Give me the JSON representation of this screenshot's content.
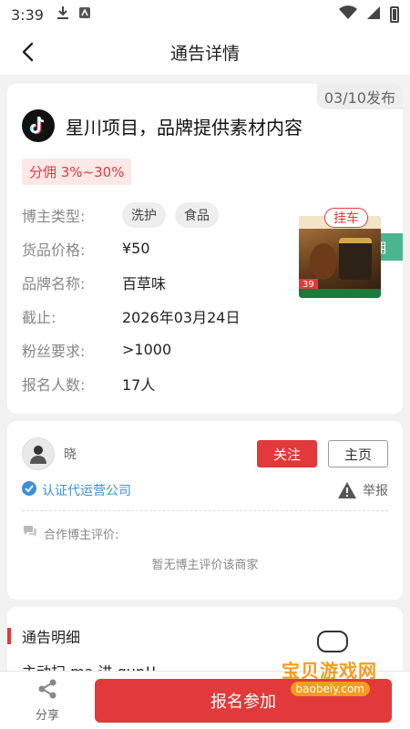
{
  "status_bar": {
    "time": "3:39"
  },
  "nav": {
    "title": "通告详情"
  },
  "ad": {
    "publish_date": "03/10发布",
    "title": "星川项目，品牌提供素材内容",
    "commission_range": "分佣 3%~30%",
    "commission_tag": "分佣",
    "hitch_badge": "挂车",
    "product_price_corner": "39",
    "info": [
      {
        "label": "博主类型:",
        "chips": [
          "洗护",
          "食品"
        ]
      },
      {
        "label": "货品价格:",
        "value": "¥50"
      },
      {
        "label": "品牌名称:",
        "value": "百草味"
      },
      {
        "label": "截止:",
        "value": "2026年03月24日"
      },
      {
        "label": "粉丝要求:",
        "value": ">1000"
      },
      {
        "label": "报名人数:",
        "value": "17人"
      }
    ]
  },
  "merchant": {
    "name": "晓",
    "follow_label": "关注",
    "home_label": "主页",
    "verified_text": "认证代运营公司",
    "report_label": "举报",
    "review_title": "合作博主评价:",
    "no_review_text": "暂无博主评价该商家"
  },
  "detail": {
    "section_title": "通告明细",
    "text": "主动扫 ma 进 qun!!"
  },
  "bottom": {
    "share_label": "分享",
    "signup_label": "报名参加"
  },
  "watermark": {
    "title": "宝贝游戏网",
    "url": "baobeiy.com"
  },
  "colors": {
    "accent_red": "#e2393a",
    "commission_green": "#4ab58f",
    "verify_blue": "#3d8fd8"
  }
}
